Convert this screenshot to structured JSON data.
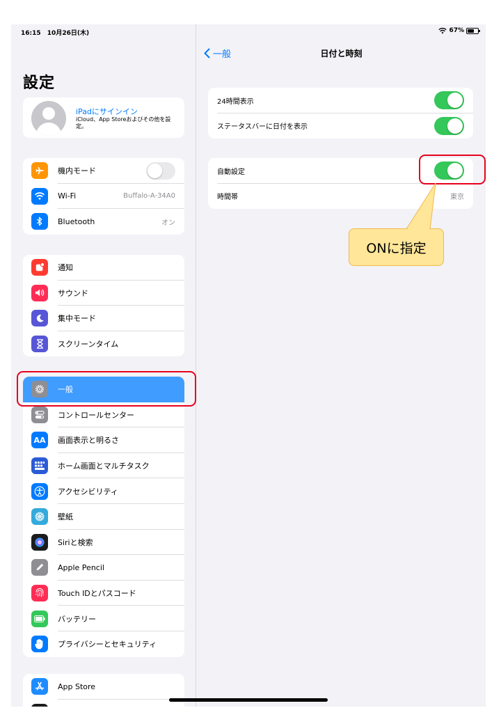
{
  "status": {
    "time": "16:15",
    "date": "10月26日(木)",
    "battery": "67%",
    "battery_level": 0.67
  },
  "sidebar": {
    "title": "設定",
    "account": {
      "title": "iPadにサインイン",
      "subtitle": "iCloud、App Storeおよびその他を設定。"
    },
    "group1": [
      {
        "label": "機内モード",
        "icon": "airplane-icon",
        "color": "#ff9500",
        "toggle": false
      },
      {
        "label": "Wi-Fi",
        "icon": "wifi-icon",
        "color": "#007aff",
        "value": "Buffalo-A-34A0"
      },
      {
        "label": "Bluetooth",
        "icon": "bluetooth-icon",
        "color": "#007aff",
        "value": "オン"
      }
    ],
    "group2": [
      {
        "label": "通知",
        "icon": "bell-icon",
        "color": "#ff3b30"
      },
      {
        "label": "サウンド",
        "icon": "speaker-icon",
        "color": "#ff2d55"
      },
      {
        "label": "集中モード",
        "icon": "moon-icon",
        "color": "#5856d6"
      },
      {
        "label": "スクリーンタイム",
        "icon": "hourglass-icon",
        "color": "#5856d6"
      }
    ],
    "group3": [
      {
        "label": "一般",
        "icon": "gear-icon",
        "color": "#8e8e93",
        "selected": true
      },
      {
        "label": "コントロールセンター",
        "icon": "switches-icon",
        "color": "#8e8e93"
      },
      {
        "label": "画面表示と明るさ",
        "icon": "text-size-icon",
        "color": "#007aff"
      },
      {
        "label": "ホーム画面とマルチタスク",
        "icon": "grid-icon",
        "color": "#2c5bd6"
      },
      {
        "label": "アクセシビリティ",
        "icon": "accessibility-icon",
        "color": "#007aff"
      },
      {
        "label": "壁紙",
        "icon": "flower-icon",
        "color": "#34aadc"
      },
      {
        "label": "Siriと検索",
        "icon": "siri-icon",
        "color": "#222222"
      },
      {
        "label": "Apple Pencil",
        "icon": "pencil-icon",
        "color": "#8e8e93"
      },
      {
        "label": "Touch IDとパスコード",
        "icon": "fingerprint-icon",
        "color": "#ff2d55"
      },
      {
        "label": "バッテリー",
        "icon": "battery-icon",
        "color": "#34c759"
      },
      {
        "label": "プライバシーとセキュリティ",
        "icon": "hand-icon",
        "color": "#007aff"
      }
    ],
    "group4": [
      {
        "label": "App Store",
        "icon": "app-store-icon",
        "color": "#1e8cff"
      }
    ]
  },
  "detail": {
    "back_label": "一般",
    "title": "日付と時刻",
    "group1": [
      {
        "label": "24時間表示",
        "toggle": true
      },
      {
        "label": "ステータスバーに日付を表示",
        "toggle": true
      }
    ],
    "group2": [
      {
        "label": "自動設定",
        "toggle": true
      },
      {
        "label": "時間帯",
        "value": "東京"
      }
    ]
  },
  "annotation": {
    "callout_text": "ONに指定",
    "highlight_color": "#e8001c",
    "callout_color": "#ffe699"
  }
}
